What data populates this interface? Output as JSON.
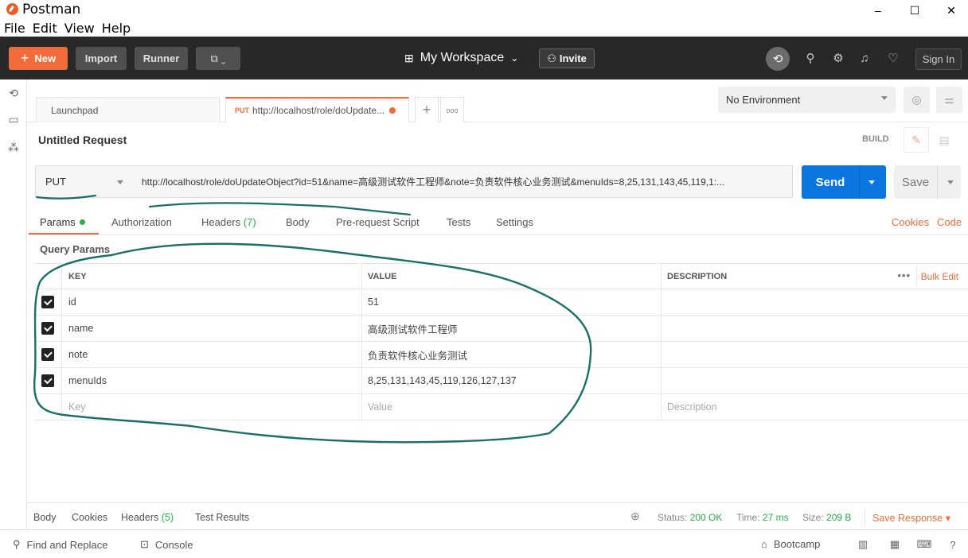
{
  "window": {
    "title": "Postman",
    "minimize": "–",
    "maximize": "☐",
    "close": "✕"
  },
  "menu": [
    "File",
    "Edit",
    "View",
    "Help"
  ],
  "header": {
    "new": "New",
    "import": "Import",
    "runner": "Runner",
    "workspace": "My Workspace",
    "invite": "Invite",
    "sign_in": "Sign In"
  },
  "tabs": {
    "launchpad": "Launchpad",
    "active_method": "PUT",
    "active_label": "http://localhost/role/doUpdate...",
    "plus": "+",
    "more": "ooo"
  },
  "environment": {
    "selected": "No Environment"
  },
  "request": {
    "title": "Untitled Request",
    "build": "BUILD",
    "method": "PUT",
    "url": "http://localhost/role/doUpdateObject?id=51&name=高级测试软件工程师&note=负责软件核心业务测试&menuIds=8,25,131,143,45,119,1:...",
    "send": "Send",
    "save": "Save"
  },
  "subtabs": {
    "params": "Params",
    "authorization": "Authorization",
    "headers": "Headers",
    "headers_count": "(7)",
    "body": "Body",
    "prerequest": "Pre-request Script",
    "tests": "Tests",
    "settings": "Settings",
    "cookies": "Cookies",
    "code": "Code"
  },
  "params": {
    "section": "Query Params",
    "columns": {
      "key": "KEY",
      "value": "VALUE",
      "description": "DESCRIPTION"
    },
    "more": "•••",
    "bulk_edit": "Bulk Edit",
    "rows": [
      {
        "key": "id",
        "value": "51",
        "checked": true
      },
      {
        "key": "name",
        "value": "高级测试软件工程师",
        "checked": true
      },
      {
        "key": "note",
        "value": "负责软件核心业务测试",
        "checked": true
      },
      {
        "key": "menuIds",
        "value": "8,25,131,143,45,119,126,127,137",
        "checked": true
      }
    ],
    "placeholder": {
      "key": "Key",
      "value": "Value",
      "description": "Description"
    }
  },
  "response": {
    "body": "Body",
    "cookies": "Cookies",
    "headers": "Headers",
    "headers_count": "(5)",
    "test_results": "Test Results",
    "status_label": "Status:",
    "status": "200 OK",
    "time_label": "Time:",
    "time": "27 ms",
    "size_label": "Size:",
    "size": "209 B",
    "save_response": "Save Response ▾"
  },
  "footer": {
    "find_replace": "Find and Replace",
    "console": "Console",
    "bootcamp": "Bootcamp"
  },
  "colors": {
    "accent": "#f26b3a",
    "send": "#0b76e0",
    "status_ok": "#26b047",
    "annotation": "#1b6f6a"
  }
}
